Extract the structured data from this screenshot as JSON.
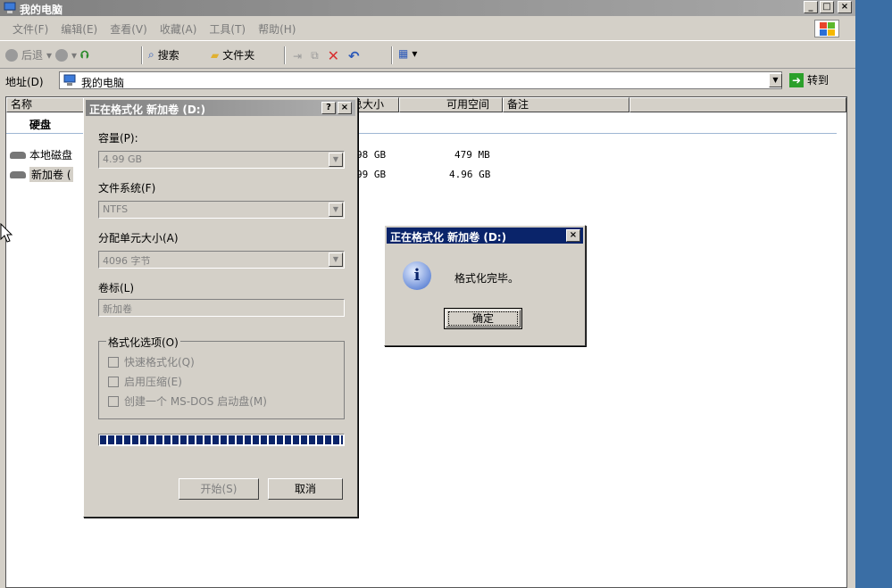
{
  "window": {
    "title": "我的电脑"
  },
  "menu": [
    "文件(F)",
    "编辑(E)",
    "查看(V)",
    "收藏(A)",
    "工具(T)",
    "帮助(H)"
  ],
  "toolbar": {
    "back": "后退",
    "search": "搜索",
    "folders": "文件夹"
  },
  "address": {
    "label": "地址(D)",
    "value": "我的电脑",
    "go": "转到"
  },
  "columns": {
    "name": "名称",
    "total": "总大小",
    "free": "可用空间",
    "note": "备注"
  },
  "group": "硬盘",
  "drives": [
    {
      "name": "本地磁盘",
      "total": "98 GB",
      "free": "479 MB"
    },
    {
      "name": "新加卷 (",
      "total": "99 GB",
      "free": "4.96 GB"
    }
  ],
  "format_dialog": {
    "title": "正在格式化 新加卷 (D:)",
    "help": "?",
    "capacity_label": "容量(P):",
    "capacity_value": "4.99 GB",
    "fs_label": "文件系统(F)",
    "fs_value": "NTFS",
    "alloc_label": "分配单元大小(A)",
    "alloc_value": "4096 字节",
    "volume_label": "卷标(L)",
    "volume_value": "新加卷",
    "options_legend": "格式化选项(O)",
    "opt_quick": "快速格式化(Q)",
    "opt_compress": "启用压缩(E)",
    "opt_msdos": "创建一个 MS-DOS 启动盘(M)",
    "progress": 1.0,
    "start": "开始(S)",
    "cancel": "取消"
  },
  "message_box": {
    "title": "正在格式化 新加卷 (D:)",
    "text": "格式化完毕。",
    "ok": "确定"
  }
}
